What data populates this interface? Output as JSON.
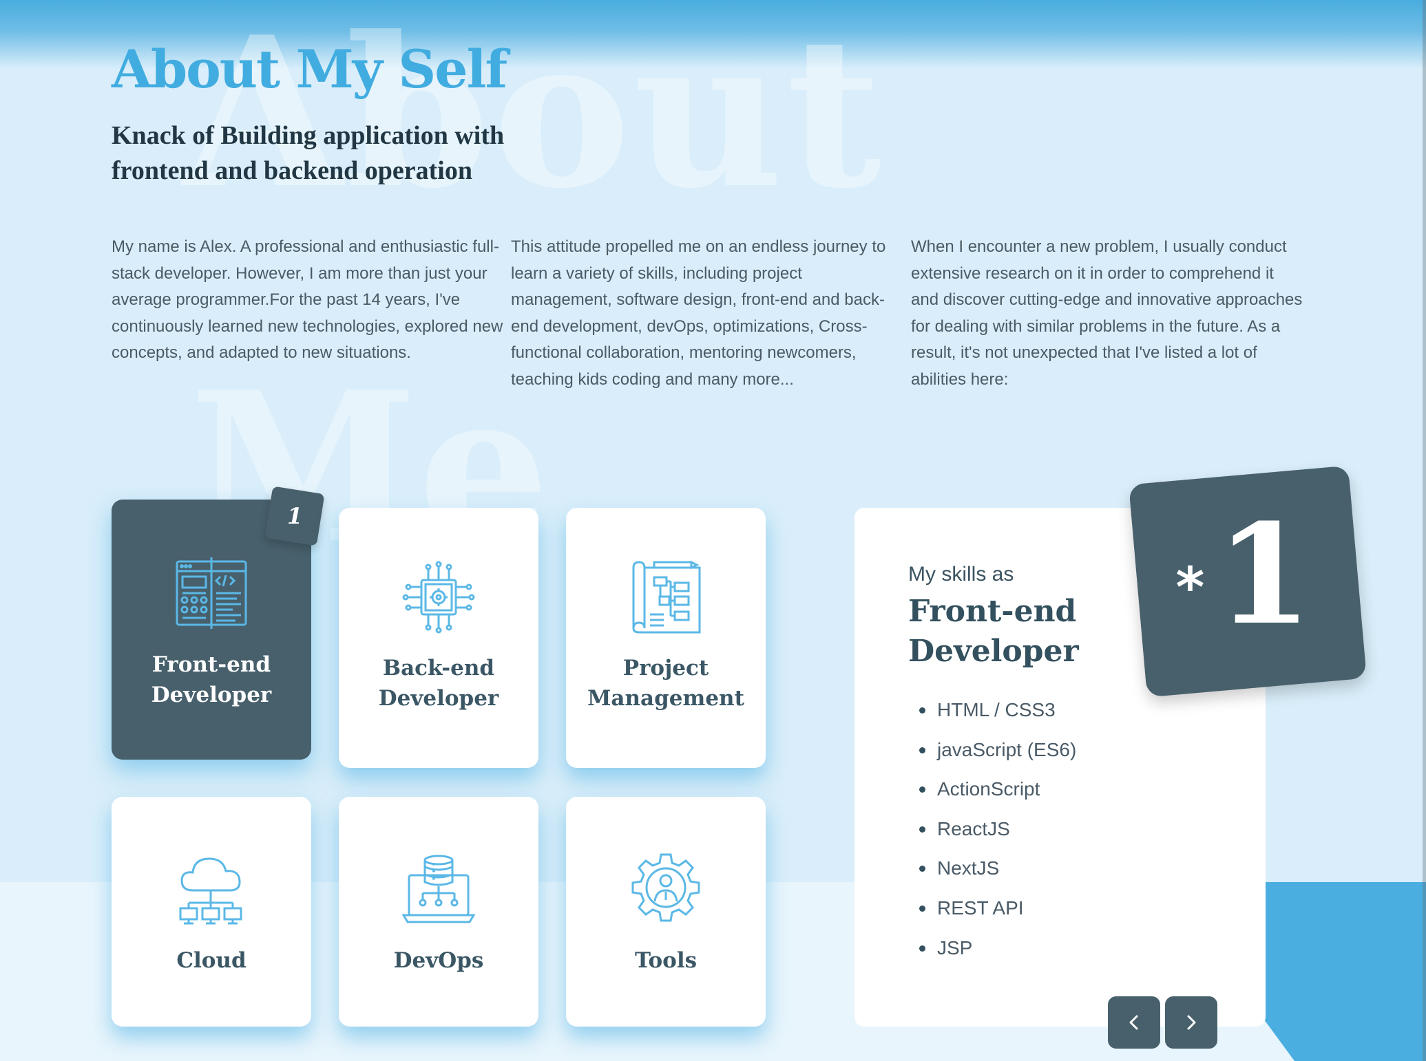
{
  "watermark": {
    "line1": "About",
    "line2": "Me"
  },
  "header": {
    "title": "About My Self",
    "subtitle": "Knack of Building application with frontend and backend operation"
  },
  "paragraphs": [
    "My name is Alex. A professional and enthusiastic full-stack developer. However, I am more than just your average programmer.For the past 14 years, I've continuously learned new technologies, explored new concepts, and adapted to new situations.",
    "This attitude propelled me on an endless journey to learn a variety of skills, including project management, software design, front-end and back-end development, devOps, optimizations, Cross-functional collaboration, mentoring newcomers, teaching kids coding and many more...",
    "When I encounter a new problem, I usually conduct extensive research on it in order to comprehend it and discover cutting-edge and innovative approaches for dealing with similar problems in the future. As a result, it's not unexpected that I've listed a lot of abilities here:"
  ],
  "cards": [
    {
      "label": "Front-end Developer",
      "icon": "browser-code-icon",
      "active": true
    },
    {
      "label": "Back-end Developer",
      "icon": "chip-gear-icon",
      "active": false
    },
    {
      "label": "Project Management",
      "icon": "blueprint-flowchart-icon",
      "active": false
    },
    {
      "label": "Cloud",
      "icon": "cloud-network-icon",
      "active": false
    },
    {
      "label": "DevOps",
      "icon": "database-laptop-icon",
      "active": false
    },
    {
      "label": "Tools",
      "icon": "gear-user-icon",
      "active": false
    }
  ],
  "active_card_badge": "1",
  "detail": {
    "kicker": "My skills as",
    "heading": "Front-end Developer",
    "badge_star": "*",
    "badge_number": "1",
    "skills": [
      "HTML / CSS3",
      "javaScript (ES6)",
      "ActionScript",
      "ReactJS",
      "NextJS",
      "REST API",
      "JSP"
    ]
  },
  "nav": {
    "prev_icon": "chevron-left-icon",
    "next_icon": "chevron-right-icon"
  },
  "colors": {
    "accent_blue": "#41ace0",
    "dark_slate": "#47606c",
    "background": "#d9eefa",
    "icon_blue": "#5bb8e6"
  }
}
